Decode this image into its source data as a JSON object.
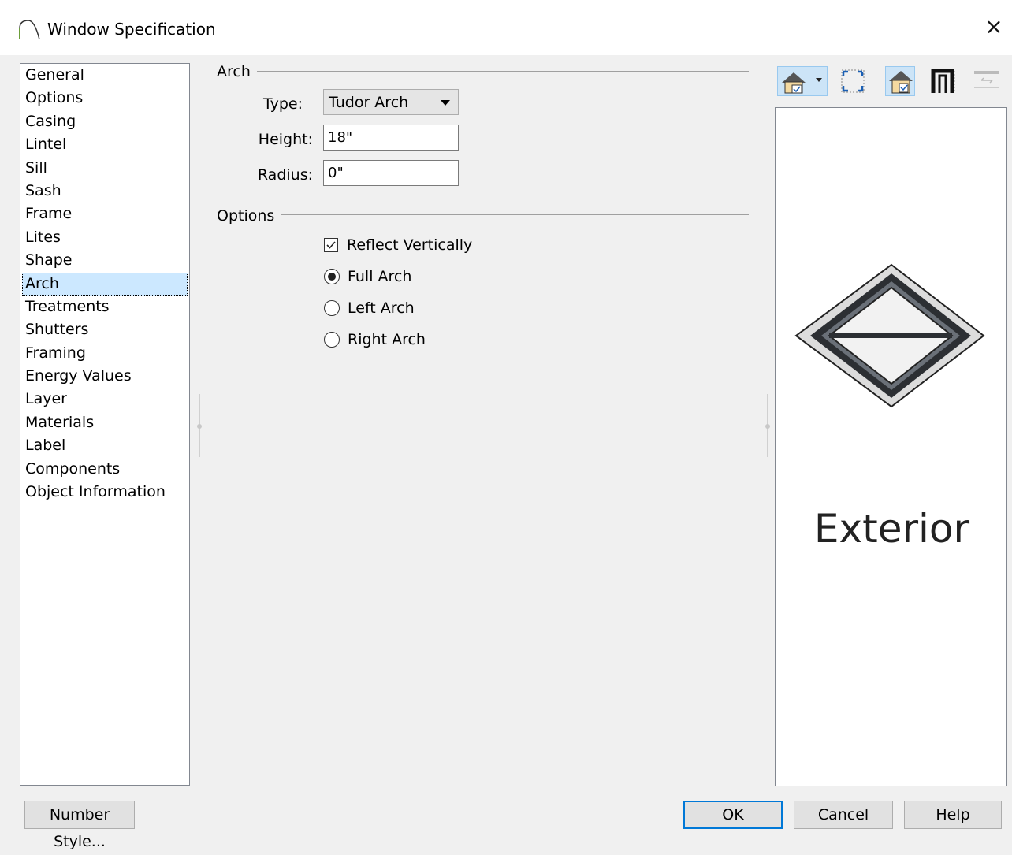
{
  "window": {
    "title": "Window Specification",
    "close_glyph": "×"
  },
  "nav": {
    "items": [
      "General",
      "Options",
      "Casing",
      "Lintel",
      "Sill",
      "Sash",
      "Frame",
      "Lites",
      "Shape",
      "Arch",
      "Treatments",
      "Shutters",
      "Framing",
      "Energy Values",
      "Layer",
      "Materials",
      "Label",
      "Components",
      "Object Information"
    ],
    "selected": "Arch"
  },
  "arch": {
    "section_label": "Arch",
    "type_label": "Type:",
    "type_value": "Tudor Arch",
    "height_label": "Height:",
    "height_value": "18\"",
    "radius_label": "Radius:",
    "radius_value": "0\""
  },
  "options": {
    "section_label": "Options",
    "reflect_vertically": {
      "label": "Reflect Vertically",
      "checked": true
    },
    "full_arch": {
      "label": "Full Arch",
      "selected": true
    },
    "left_arch": {
      "label": "Left Arch",
      "selected": false
    },
    "right_arch": {
      "label": "Right Arch",
      "selected": false
    }
  },
  "toolbar": {
    "icons": [
      "house-view-icon",
      "fill-window-icon",
      "house-check-icon",
      "door-frame-icon",
      "swap-icon"
    ]
  },
  "preview": {
    "label": "Exterior"
  },
  "buttons": {
    "number_style": "Number Style...",
    "ok": "OK",
    "cancel": "Cancel",
    "help": "Help"
  },
  "colors": {
    "accent": "#0078d7",
    "selection": "#cce8ff"
  }
}
